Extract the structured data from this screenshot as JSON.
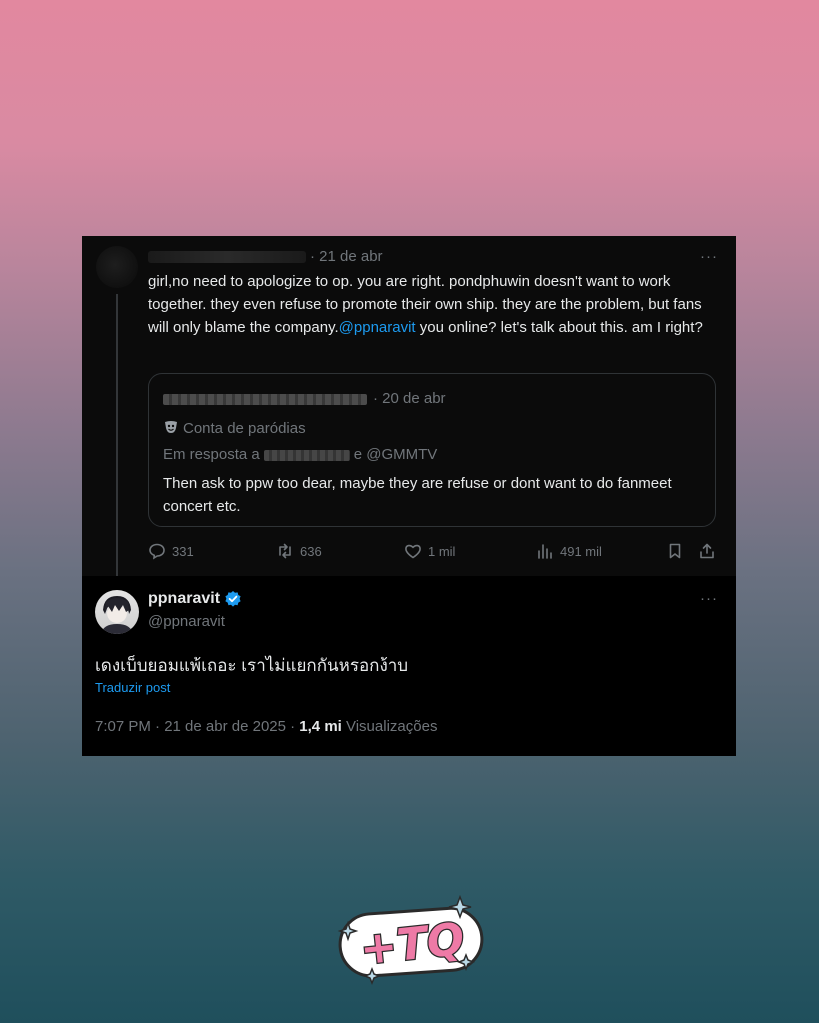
{
  "tweet1": {
    "date": "· 21 de abr",
    "text_before": "girl,no need to apologize to op. you are right. pondphuwin doesn't want to work together. they even refuse to promote their own ship. they are the problem, but fans will only blame the company.",
    "mention": "@ppnaravit",
    "text_after": "  you online? let's talk about this. am I right?",
    "more": "···",
    "quote": {
      "date": "· 20 de abr",
      "badge": "Conta de paródias",
      "reply_prefix": "Em resposta a",
      "reply_suffix": "e @GMMTV",
      "text": "Then ask to ppw too dear, maybe they are refuse or dont want to do fanmeet concert etc."
    },
    "actions": {
      "replies": "331",
      "reposts": "636",
      "likes": "1 mil",
      "views": "491 mil"
    }
  },
  "tweet2": {
    "name": "ppnaravit",
    "handle": "@ppnaravit",
    "more": "···",
    "text": "เดงเบ็บยอมแพ้เถอะ เราไม่แยกกันหรอกง้าบ",
    "translate": "Traduzir post",
    "time": "7:07 PM · 21 de abr de 2025 · ",
    "views_count": "1,4 mi",
    "views_label": " Visualizações"
  },
  "logo": {
    "text": "+TQ"
  },
  "colors": {
    "link": "#1d9bf0",
    "verified": "#1d9bf0",
    "muted": "#71767b",
    "text": "#e7e9ea"
  }
}
